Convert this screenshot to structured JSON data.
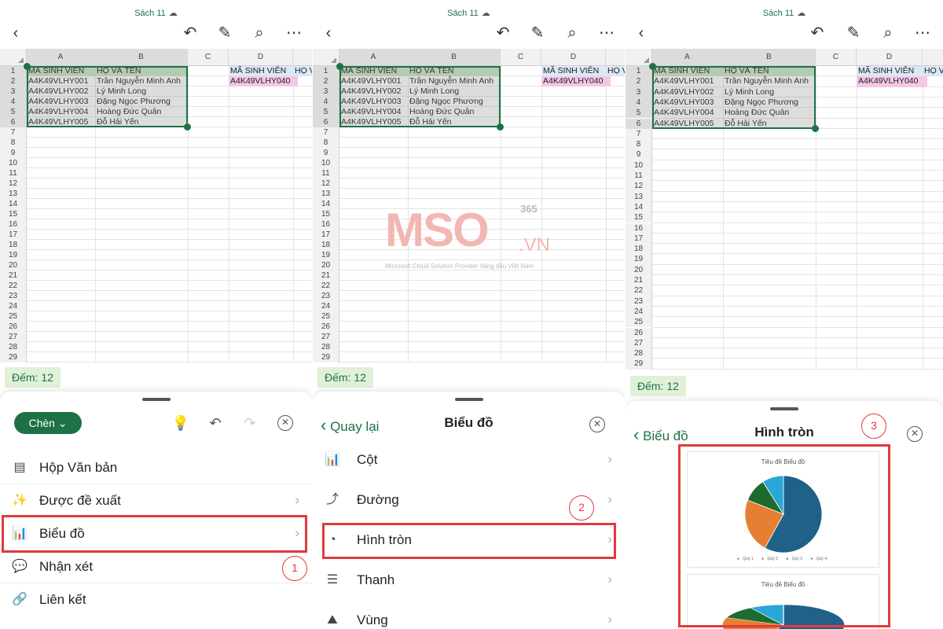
{
  "doc_title": "Sách 11",
  "columns": [
    "A",
    "B",
    "C",
    "D"
  ],
  "cells": {
    "header_code": "MÃ SINH VIÊN",
    "header_name": "HỌ VÀ TÊN",
    "d1": "MÃ SINH VIÊN",
    "e1": "HỌ V",
    "d2": "A4K49VLHY040",
    "rows": [
      {
        "code": "A4K49VLHY001",
        "name": "Trần Nguyễn Minh Anh"
      },
      {
        "code": "A4K49VLHY002",
        "name": "Lý Minh Long"
      },
      {
        "code": "A4K49VLHY003",
        "name": "Đặng Ngọc Phương"
      },
      {
        "code": "A4K49VLHY004",
        "name": "Hoàng Đức Quân"
      },
      {
        "code": "A4K49VLHY005",
        "name": "Đỗ Hải Yến"
      }
    ]
  },
  "status": {
    "count_label": "Đếm: 12"
  },
  "panel1": {
    "insert_label": "Chèn ⌄",
    "items": [
      {
        "label": "Hộp Văn bản",
        "icon": "textbox-icon"
      },
      {
        "label": "Được đề xuất",
        "icon": "magic-wand-icon"
      },
      {
        "label": "Biểu đồ",
        "icon": "chart-icon"
      },
      {
        "label": "Nhận xét",
        "icon": "comment-icon"
      },
      {
        "label": "Liên kết",
        "icon": "link-icon"
      }
    ],
    "step": "1"
  },
  "panel2": {
    "back_label": "Quay lại",
    "title": "Biểu đồ",
    "items": [
      {
        "label": "Cột",
        "icon": "column-chart-icon"
      },
      {
        "label": "Đường",
        "icon": "line-chart-icon"
      },
      {
        "label": "Hình tròn",
        "icon": "pie-chart-icon"
      },
      {
        "label": "Thanh",
        "icon": "bar-chart-icon"
      },
      {
        "label": "Vùng",
        "icon": "area-chart-icon"
      }
    ],
    "step": "2"
  },
  "panel3": {
    "back_label": "Biểu đồ",
    "title": "Hình tròn",
    "step": "3",
    "chart_preview_title": "Tiêu đề Biểu đồ",
    "legend": [
      "Quý 1",
      "Quý 2",
      "Quý 3",
      "Quý 4"
    ]
  },
  "watermark": {
    "brand": "MSO",
    "suffix": ".VN",
    "badge": "365",
    "tagline": "Microsoft Cloud Solution Provider hàng đầu Việt Nam"
  },
  "colors": {
    "accent": "#1e7145",
    "highlight": "#e03a3e",
    "pie": [
      "#1f6188",
      "#e67e33",
      "#1e6b2e",
      "#2ba6d8"
    ]
  }
}
